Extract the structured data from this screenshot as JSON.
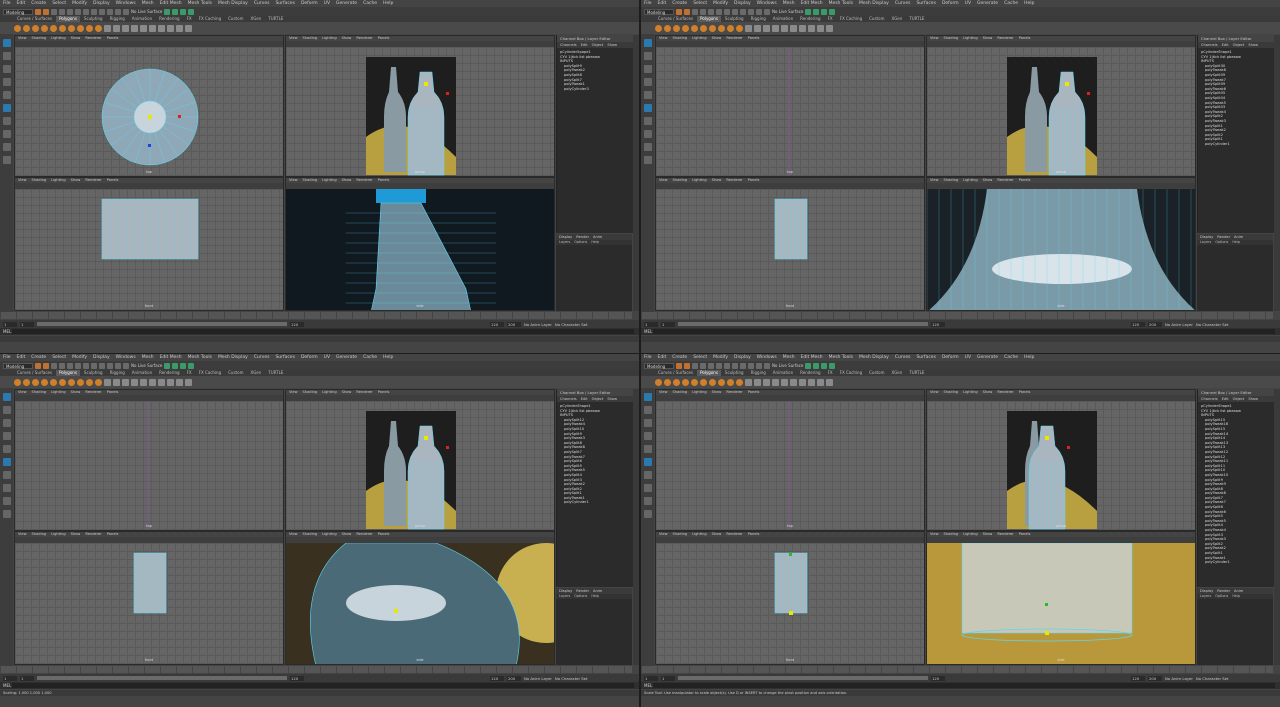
{
  "menus": [
    "File",
    "Edit",
    "Create",
    "Select",
    "Modify",
    "Display",
    "Windows",
    "Mesh",
    "Edit Mesh",
    "Mesh Tools",
    "Mesh Display",
    "Curves",
    "Surfaces",
    "Deform",
    "UV",
    "Generate",
    "Cache",
    "Help"
  ],
  "mode": "Modeling",
  "live_surface": "No Live Surface",
  "shelf_tabs": [
    "Curves / Surfaces",
    "Polygons",
    "Sculpting",
    "Rigging",
    "Animation",
    "Rendering",
    "FX",
    "FX Caching",
    "Custom",
    "XGen",
    "TURTLE"
  ],
  "shelf_active": "Polygons",
  "viewport_menus": [
    "View",
    "Shading",
    "Lighting",
    "Show",
    "Renderer",
    "Panels"
  ],
  "vp_labels": {
    "top": "top",
    "persp": "persp",
    "front": "front",
    "side": "side"
  },
  "panel_title": "Channel Box / Layer Editor",
  "channel_menu": [
    "Channels",
    "Edit",
    "Object",
    "Show"
  ],
  "layer_tabs": [
    "Display",
    "Render",
    "Anim"
  ],
  "layer_menu": [
    "Layers",
    "Options",
    "Help"
  ],
  "range": {
    "start": "1",
    "start2": "1",
    "current": "120",
    "end": "120",
    "end2": "200"
  },
  "anim_layer": "No Anim Layer",
  "char_set": "No Character Set",
  "mel": "MEL",
  "quads": [
    {
      "outliner": [
        "pCylinder5pape1",
        "CYV 1|tick list pbeaaw",
        "INPUTS",
        "polySplit9",
        "polyTweak2",
        "polySplit8",
        "polySplit7",
        "polyTweak1",
        "polyCylinder3"
      ],
      "help": ""
    },
    {
      "outliner": [
        "pCylinderShape1",
        "CYV 1|tick list pbeaaw",
        "INPUTS",
        "polySplit30",
        "polyTweak8",
        "polySplit09",
        "polyTweak7",
        "polySplit09",
        "polyTweak6",
        "polySplit05",
        "polySplit04",
        "polyTweak5",
        "polySplit03",
        "polyTweak4",
        "polySplit2",
        "polyTweak3",
        "polySplit1",
        "polyTweak2",
        "polySplit2",
        "polySplit1",
        "polyCylinder1"
      ],
      "help": ""
    },
    {
      "outliner": [
        "pCylinderShape1",
        "CYV 1|tick list pbeaaw",
        "INPUTS",
        "polySplit12",
        "polyTweak4",
        "polySplit10",
        "polySplit9",
        "polyTweak3",
        "polySplit8",
        "polyTweak8",
        "polySplit7",
        "polyTweak7",
        "polySplit6",
        "polySplit5",
        "polyTweak5",
        "polySplit4",
        "polySplit3",
        "polyTweak2",
        "polySplit2",
        "polySplit1",
        "polyTweak1",
        "polyCylinder1"
      ],
      "help": "Scaling: 1.000 1.000 1.000"
    },
    {
      "outliner": [
        "pCylinderShape1",
        "CYV 1|tick list pbeaaw",
        "INPUTS",
        "polySplit15",
        "polyTweak16",
        "polySplit15",
        "polyTweak14",
        "polySplit14",
        "polyTweak13",
        "polySplit13",
        "polyTweak12",
        "polySplit12",
        "polyTweak11",
        "polySplit11",
        "polySplit10",
        "polyTweak10",
        "polySplit9",
        "polyTweak9",
        "polySplit8",
        "polyTweak8",
        "polySplit7",
        "polyTweak7",
        "polySplit6",
        "polyTweak6",
        "polySplit5",
        "polyTweak5",
        "polySplit4",
        "polyTweak4",
        "polySplit3",
        "polyTweak3",
        "polySplit2",
        "polyTweak2",
        "polySplit1",
        "polyTweak1",
        "polyCylinder1"
      ],
      "help": "Scale Tool: Use manipulator to scale object(s). Use D or INSERT to change the pivot position and axis orientation."
    }
  ]
}
